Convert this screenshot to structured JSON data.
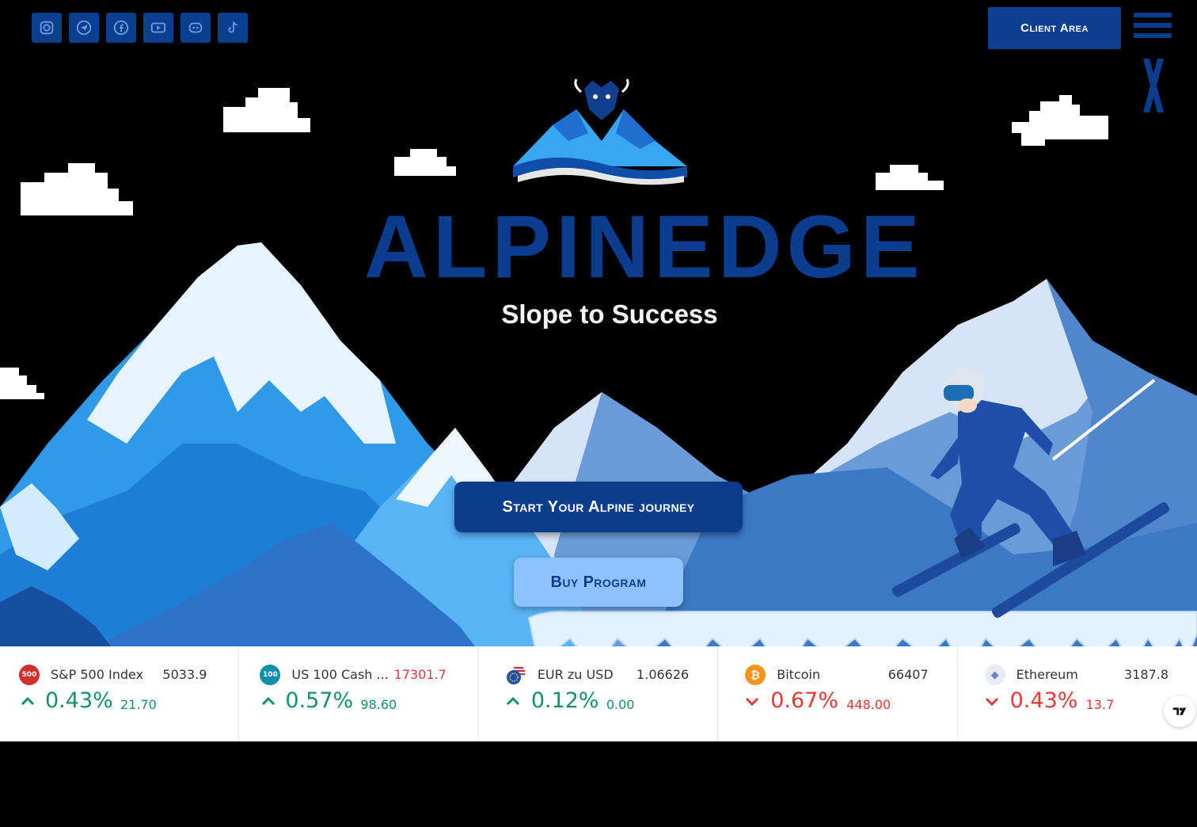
{
  "header": {
    "social_icons": [
      "instagram-icon",
      "telegram-icon",
      "facebook-icon",
      "youtube-icon",
      "discord-icon",
      "tiktok-icon"
    ],
    "client_area_label": "Client Area"
  },
  "hero": {
    "brand": "ALPINEDGE",
    "tagline": "Slope to Success",
    "cta_primary": "Start Your Alpine journey",
    "cta_secondary": "Buy Program"
  },
  "ticker": {
    "items": [
      {
        "logo_text": "500",
        "logo_color": "#d32f2f",
        "name": "S&P 500 Index",
        "price": "5033.9",
        "price_color": "neutral",
        "direction": "up",
        "percent": "0.43%",
        "change": "21.70"
      },
      {
        "logo_text": "100",
        "logo_color": "#0e8fa6",
        "name": "US 100 Cash ...",
        "price": "17301.7",
        "price_color": "red",
        "direction": "up",
        "percent": "0.57%",
        "change": "98.60"
      },
      {
        "logo_text": "",
        "logo_color": "#1e4fb3",
        "name": "EUR zu USD",
        "price": "1.06626",
        "price_color": "neutral",
        "direction": "up",
        "percent": "0.12%",
        "change": "0.00"
      },
      {
        "logo_text": "₿",
        "logo_color": "#f7931a",
        "name": "Bitcoin",
        "price": "66407",
        "price_color": "neutral",
        "direction": "down",
        "percent": "0.67%",
        "change": "448.00"
      },
      {
        "logo_text": "◆",
        "logo_color": "#e8ecf7",
        "name": "Ethereum",
        "price": "3187.8",
        "price_color": "neutral",
        "direction": "down",
        "percent": "0.43%",
        "change": "13.7"
      }
    ]
  },
  "colors": {
    "navy": "#0b3d8f",
    "light_blue_button": "#8cc3ff",
    "positive": "#10916e",
    "negative": "#e53935"
  }
}
